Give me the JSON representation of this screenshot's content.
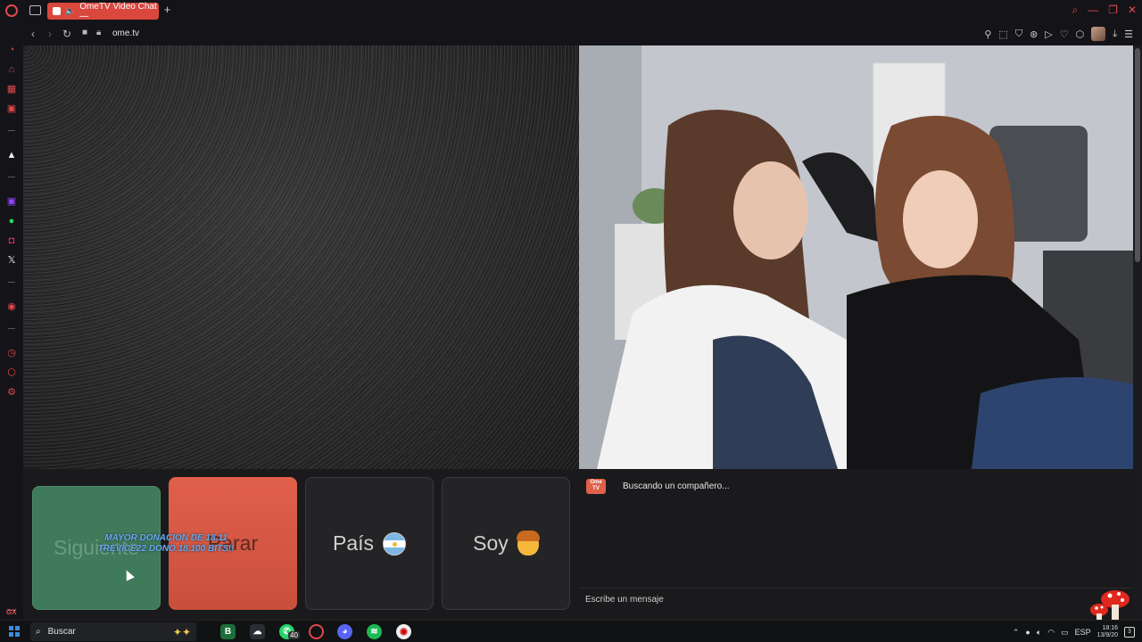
{
  "browser": {
    "tab_title": "OmeTV Video Chat —",
    "new_tab": "+",
    "url": "ome.tv"
  },
  "controls": {
    "next_label": "Siguiente",
    "stop_label": "Parar",
    "country_label": "País",
    "gender_label": "Soy"
  },
  "overlay": {
    "donation_line1": "MAYOR DONACION DE 18.11",
    "donation_line2": "TREVICE22 DONO 18.100 BITS!!"
  },
  "chat": {
    "logo_text": "Ome TV",
    "status": "Buscando un compañero...",
    "input_placeholder": "Escribe un mensaje"
  },
  "taskbar": {
    "search_placeholder": "Buscar",
    "whatsapp_badge": "40",
    "language": "ESP",
    "time": "18:16",
    "date": "13/9/20",
    "notifications": "3",
    "sidebar_gx": "GX"
  },
  "colors": {
    "opera_red": "#e0484c",
    "next_green": "#3f7a5a",
    "stop_red": "#d9573f"
  }
}
